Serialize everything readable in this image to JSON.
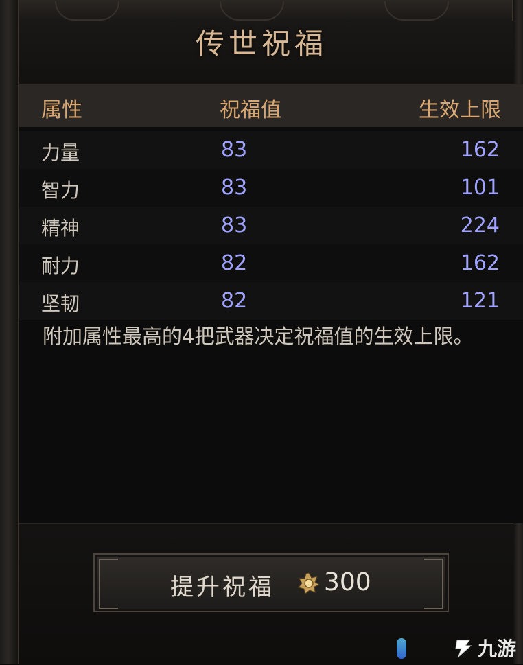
{
  "window": {
    "title": "传世祝福"
  },
  "table": {
    "headers": {
      "attribute": "属性",
      "blessing": "祝福值",
      "limit": "生效上限"
    },
    "rows": [
      {
        "attribute": "力量",
        "blessing": "83",
        "limit": "162"
      },
      {
        "attribute": "智力",
        "blessing": "83",
        "limit": "101"
      },
      {
        "attribute": "精神",
        "blessing": "83",
        "limit": "224"
      },
      {
        "attribute": "耐力",
        "blessing": "82",
        "limit": "162"
      },
      {
        "attribute": "坚韧",
        "blessing": "82",
        "limit": "121"
      }
    ]
  },
  "note": "附加属性最高的4把武器决定祝福值的生效上限。",
  "action": {
    "label": "提升祝福",
    "cost_icon": "currency-gem-icon",
    "cost": "300"
  },
  "watermark": {
    "text": "九游",
    "icon": "logo-icon"
  },
  "colors": {
    "header_text": "#d9a872",
    "value_blue": "#9fa3ff",
    "title_gold": "#d8b894"
  }
}
